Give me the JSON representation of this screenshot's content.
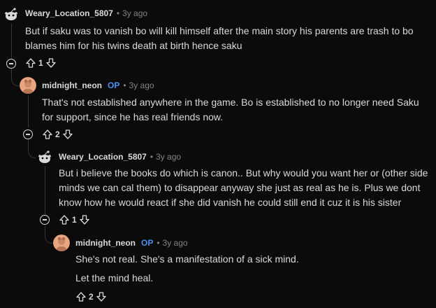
{
  "comments": [
    {
      "username": "Weary_Location_5807",
      "op": "",
      "time": "3y ago",
      "lines": [
        "But if saku was to vanish bo will kill himself after the main story his parents are trash to bo blames him for his twins death at birth hence saku"
      ],
      "score": "1",
      "avatar": "snoo-icon"
    },
    {
      "username": "midnight_neon",
      "op": "OP",
      "time": "3y ago",
      "lines": [
        "That's not established anywhere in the game. Bo is established to no longer need Saku for support, since he has real friends now."
      ],
      "score": "2",
      "avatar": "user-avatar"
    },
    {
      "username": "Weary_Location_5807",
      "op": "",
      "time": "3y ago",
      "lines": [
        "But i believe the books do which is canon.. But why would you want her or (other side minds we can cal them) to disappear anyway she just as real as he is. Plus we dont know how he would react if she did vanish he could still end it cuz it is his sister"
      ],
      "score": "1",
      "avatar": "snoo-icon"
    },
    {
      "username": "midnight_neon",
      "op": "OP",
      "time": "3y ago",
      "lines": [
        "She's not real. She's a manifestation of a sick mind.",
        "Let the mind heal."
      ],
      "score": "2",
      "avatar": "user-avatar"
    }
  ],
  "separator": "•",
  "colors": {
    "background": "#0b0b0b",
    "op": "#4a8ff0",
    "muted": "#818384",
    "text": "#d7dadc"
  }
}
